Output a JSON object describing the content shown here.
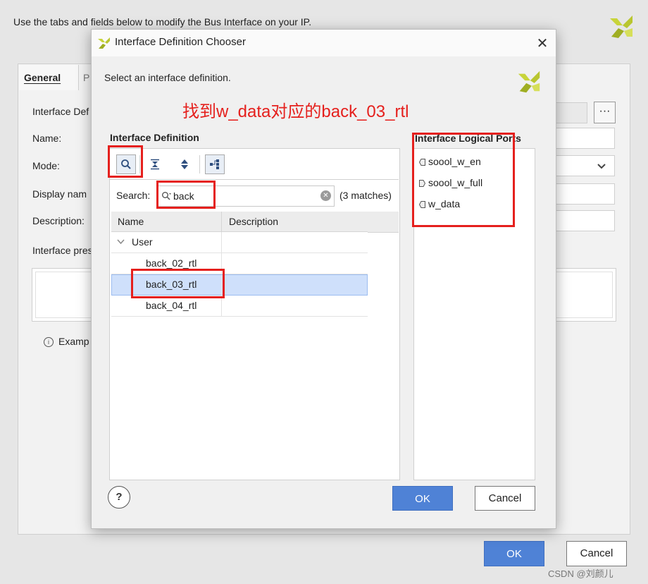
{
  "background_dialog": {
    "instruction": "Use the tabs and fields below to modify the Bus Interface on your IP.",
    "tabs": [
      {
        "label": "General"
      },
      {
        "label": "P"
      }
    ],
    "labels": {
      "interface_def": "Interface Def",
      "name": "Name:",
      "mode": "Mode:",
      "display_name": "Display nam",
      "description": "Description:",
      "interface_preview": "Interface pres",
      "example": "Examp"
    },
    "browse_button": "···",
    "ok_label": "OK",
    "cancel_label": "Cancel"
  },
  "dialog": {
    "title": "Interface Definition Chooser",
    "close_glyph": "✕",
    "subtitle": "Select an interface definition.",
    "annotation": "找到w_data对应的back_03_rtl",
    "definition_panel": {
      "heading": "Interface Definition",
      "search": {
        "label": "Search:",
        "value": "back",
        "match_count": "(3 matches)"
      },
      "columns": {
        "name": "Name",
        "description": "Description"
      },
      "group": "User",
      "rows": [
        {
          "name": "back_02_rtl",
          "description": ""
        },
        {
          "name": "back_03_rtl",
          "description": "",
          "selected": true
        },
        {
          "name": "back_04_rtl",
          "description": ""
        }
      ]
    },
    "ports_panel": {
      "heading": "Interface Logical Ports",
      "ports": [
        {
          "name": "soool_w_en",
          "direction": "in"
        },
        {
          "name": "soool_w_full",
          "direction": "out"
        },
        {
          "name": "w_data",
          "direction": "in"
        }
      ]
    },
    "help_label": "?",
    "ok_label": "OK",
    "cancel_label": "Cancel"
  },
  "watermark": "CSDN @刘颜儿",
  "colors": {
    "accent": "#4f82d6",
    "selection": "#cfe0fb",
    "annotation_red": "#e5201d",
    "logo_yellow": "#c8d43a"
  }
}
